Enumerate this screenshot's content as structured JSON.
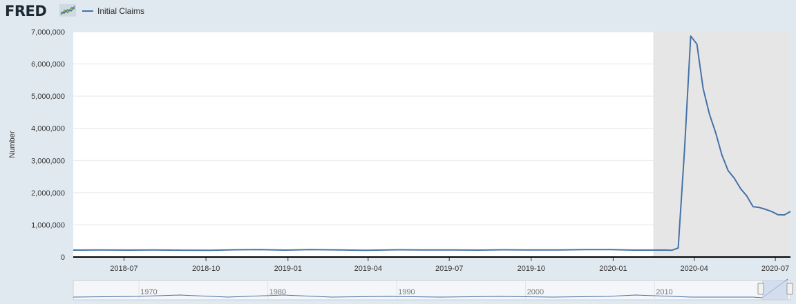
{
  "header": {
    "logo_text": "FRED",
    "legend_label": "Initial Claims"
  },
  "colors": {
    "series": "#4572a7",
    "recession_shade": "#e6e6e6",
    "background": "#e1e9f0"
  },
  "icons": {
    "logo_mark": "fred-graph-icon"
  },
  "navigator": {
    "labels": [
      "1970",
      "1980",
      "1990",
      "2000",
      "2010"
    ]
  },
  "chart_data": {
    "type": "line",
    "title": "",
    "ylabel": "Number",
    "xlabel": "",
    "ylim": [
      0,
      7000000
    ],
    "yticks": [
      0,
      1000000,
      2000000,
      3000000,
      4000000,
      5000000,
      6000000,
      7000000
    ],
    "ytick_labels": [
      "0",
      "1,000,000",
      "2,000,000",
      "3,000,000",
      "4,000,000",
      "5,000,000",
      "6,000,000",
      "7,000,000"
    ],
    "xlim": [
      "2018-05-05",
      "2020-07-18"
    ],
    "xticks": [
      "2018-07-01",
      "2018-10-01",
      "2019-01-01",
      "2019-04-01",
      "2019-07-01",
      "2019-10-01",
      "2020-01-01",
      "2020-04-01",
      "2020-07-01"
    ],
    "xtick_labels": [
      "2018-07",
      "2018-10",
      "2019-01",
      "2019-04",
      "2019-07",
      "2019-10",
      "2020-01",
      "2020-04",
      "2020-07"
    ],
    "grid": true,
    "recession": {
      "start": "2020-02-15",
      "end": "2020-07-18"
    },
    "series": [
      {
        "name": "Initial Claims",
        "x": [
          "2018-05-05",
          "2018-06-02",
          "2018-07-07",
          "2018-08-04",
          "2018-09-01",
          "2018-10-06",
          "2018-11-03",
          "2018-12-01",
          "2018-12-29",
          "2019-01-26",
          "2019-03-02",
          "2019-03-30",
          "2019-05-04",
          "2019-06-01",
          "2019-07-06",
          "2019-08-03",
          "2019-08-31",
          "2019-10-05",
          "2019-11-02",
          "2019-11-30",
          "2019-12-28",
          "2020-01-25",
          "2020-02-29",
          "2020-03-07",
          "2020-03-14",
          "2020-03-21",
          "2020-03-28",
          "2020-04-04",
          "2020-04-11",
          "2020-04-18",
          "2020-04-25",
          "2020-05-02",
          "2020-05-09",
          "2020-05-16",
          "2020-05-23",
          "2020-05-30",
          "2020-06-06",
          "2020-06-13",
          "2020-06-20",
          "2020-06-27",
          "2020-07-04",
          "2020-07-11",
          "2020-07-18"
        ],
        "y": [
          215000,
          220000,
          215000,
          220000,
          213000,
          210000,
          225000,
          230000,
          215000,
          230000,
          220000,
          210000,
          225000,
          222000,
          220000,
          215000,
          225000,
          218000,
          220000,
          230000,
          232000,
          215000,
          217000,
          211000,
          282000,
          3307000,
          6867000,
          6615000,
          5237000,
          4442000,
          3867000,
          3176000,
          2687000,
          2446000,
          2126000,
          1897000,
          1566000,
          1540000,
          1482000,
          1413000,
          1314000,
          1307000,
          1416000
        ]
      }
    ]
  }
}
